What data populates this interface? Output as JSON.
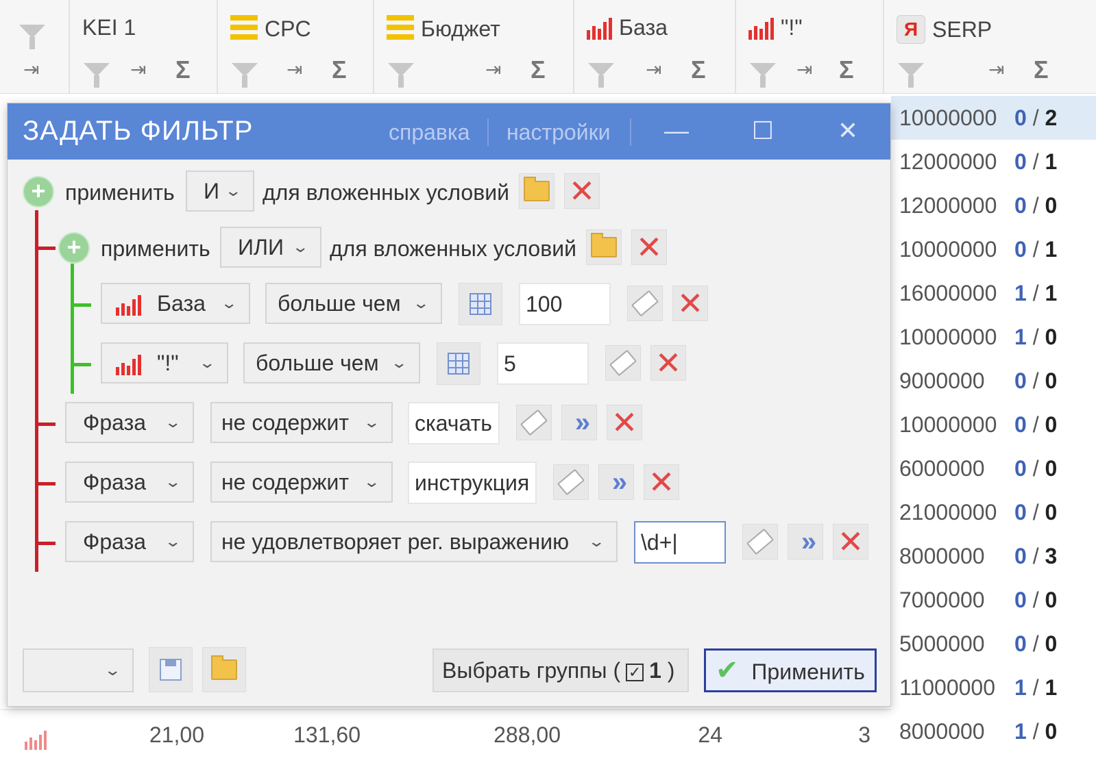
{
  "columns": [
    {
      "title": "KEI 1",
      "icon": "none"
    },
    {
      "title": "CPC",
      "icon": "yellow-bars-icon"
    },
    {
      "title": "Бюджет",
      "icon": "yellow-bars-icon"
    },
    {
      "title": "База",
      "icon": "red-bars-icon"
    },
    {
      "title": "\"!\"",
      "icon": "red-bars-icon"
    },
    {
      "title": "SERP",
      "icon": "yandex-icon",
      "badge": "Я"
    }
  ],
  "header_icons": {
    "filter": "funnel-icon",
    "pin": "pin-icon",
    "sum": "Σ",
    "pin_glyph": "⇥"
  },
  "right_rows": [
    {
      "value": "10000000",
      "a": "0",
      "b": "2"
    },
    {
      "value": "12000000",
      "a": "0",
      "b": "1"
    },
    {
      "value": "12000000",
      "a": "0",
      "b": "0"
    },
    {
      "value": "10000000",
      "a": "0",
      "b": "1"
    },
    {
      "value": "16000000",
      "a": "1",
      "b": "1"
    },
    {
      "value": "10000000",
      "a": "1",
      "b": "0"
    },
    {
      "value": "9000000",
      "a": "0",
      "b": "0"
    },
    {
      "value": "10000000",
      "a": "0",
      "b": "0"
    },
    {
      "value": "6000000",
      "a": "0",
      "b": "0"
    },
    {
      "value": "21000000",
      "a": "0",
      "b": "0"
    },
    {
      "value": "8000000",
      "a": "0",
      "b": "3"
    },
    {
      "value": "7000000",
      "a": "0",
      "b": "0"
    },
    {
      "value": "5000000",
      "a": "0",
      "b": "0"
    },
    {
      "value": "11000000",
      "a": "1",
      "b": "1"
    },
    {
      "value": "8000000",
      "a": "1",
      "b": "0"
    }
  ],
  "footer": {
    "kei": "21,00",
    "cpc": "131,60",
    "budget": "288,00",
    "base": "24",
    "excl": "3"
  },
  "dialog": {
    "title": "ЗАДАТЬ ФИЛЬТР",
    "help": "справка",
    "settings": "настройки",
    "min_glyph": "—",
    "max_glyph": "☐",
    "close_glyph": "✕",
    "apply_word": "применить",
    "nested_word": "для вложенных условий",
    "group1_op": "И",
    "group2_op": "ИЛИ",
    "rows": [
      {
        "field": "База",
        "cond": "больше чем",
        "value": "100"
      },
      {
        "field": "\"!\"",
        "cond": "больше чем",
        "value": "5"
      },
      {
        "field": "Фраза",
        "cond": "не содержит",
        "value": "скачать"
      },
      {
        "field": "Фраза",
        "cond": "не содержит",
        "value": "инструкция"
      },
      {
        "field": "Фраза",
        "cond": "не удовлетворяет рег. выражению",
        "value": "\\d+|"
      }
    ],
    "preset_value": "",
    "groups_label_pre": "Выбрать группы (",
    "groups_count": "1",
    "groups_label_post": ")",
    "apply_label": "Применить"
  },
  "glyphs": {
    "chevron": "⌄",
    "x": "✕",
    "dbl": "»",
    "plus": "+",
    "check": "✔",
    "checkbox": "✓"
  }
}
